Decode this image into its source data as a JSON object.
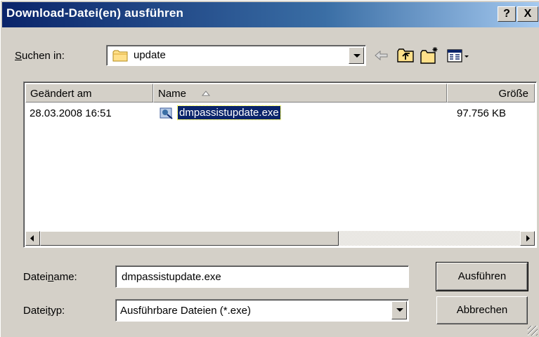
{
  "window": {
    "title": "Download-Datei(en) ausführen"
  },
  "titlebar": {
    "help_label": "?",
    "close_label": "X"
  },
  "lookin": {
    "label_pre": "",
    "label_u": "S",
    "label_post": "uchen in:",
    "value": "update"
  },
  "toolbar": {
    "icons": [
      "back-arrow-icon",
      "up-folder-icon",
      "new-folder-icon",
      "view-menu-icon"
    ]
  },
  "filelist": {
    "columns": [
      "Geändert am",
      "Name",
      "Größe"
    ],
    "rows": [
      {
        "modified": "28.03.2008 16:51",
        "name": "dmpassistupdate.exe",
        "size": "97.756 KB"
      }
    ]
  },
  "filename": {
    "label_pre": "Datei",
    "label_u": "n",
    "label_post": "ame:",
    "value": "dmpassistupdate.exe"
  },
  "filetype": {
    "label_pre": "Datei",
    "label_u": "t",
    "label_post": "yp:",
    "value": "Ausführbare Dateien (*.exe)"
  },
  "buttons": {
    "execute": "Ausführen",
    "cancel": "Abbrechen"
  },
  "colors": {
    "titlebar_start": "#0a246a",
    "titlebar_end": "#a6caf0",
    "dialog_bg": "#d4d0c8",
    "selection": "#0a246a"
  }
}
